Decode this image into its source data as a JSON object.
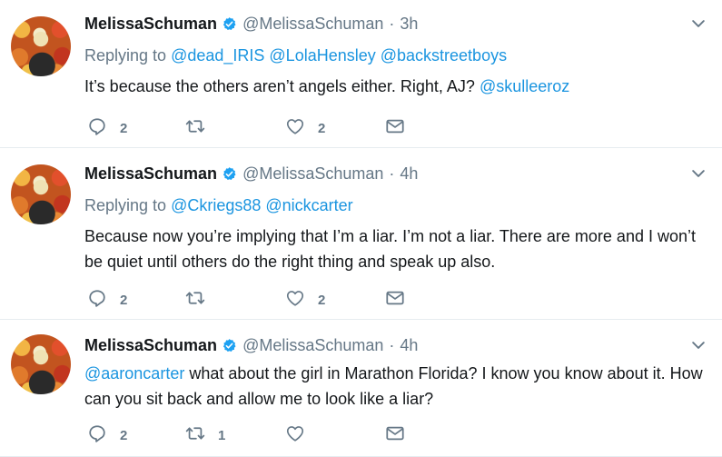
{
  "colors": {
    "link": "#1b95e0",
    "meta": "#657786",
    "text": "#14171a",
    "verified": "#1da1f2"
  },
  "tweets": [
    {
      "name": "MelissaSchuman",
      "handle": "@MelissaSchuman",
      "separator": "·",
      "time": "3h",
      "replying_prefix": "Replying to",
      "replying_to": [
        "@dead_IRIS",
        "@LolaHensley",
        "@backstreetboys"
      ],
      "text": "It’s because the others aren’t angels either. Right, AJ?",
      "text_mention_suffix": "@skulleeroz",
      "counts": {
        "replies": "2",
        "retweets": "",
        "likes": "2"
      }
    },
    {
      "name": "MelissaSchuman",
      "handle": "@MelissaSchuman",
      "separator": "·",
      "time": "4h",
      "replying_prefix": "Replying to",
      "replying_to": [
        "@Ckriegs88",
        "@nickcarter"
      ],
      "text": "Because now you’re implying that I’m a liar. I’m not a liar. There are more and I won’t be quiet until others do the right thing and speak up also.",
      "counts": {
        "replies": "2",
        "retweets": "",
        "likes": "2"
      }
    },
    {
      "name": "MelissaSchuman",
      "handle": "@MelissaSchuman",
      "separator": "·",
      "time": "4h",
      "text_mention_prefix": "@aaroncarter",
      "text": "what about the girl in Marathon Florida? I know you know about it. How can you sit back and allow me to look like a liar?",
      "counts": {
        "replies": "2",
        "retweets": "1",
        "likes": ""
      }
    }
  ],
  "icons": {
    "reply": "reply-icon",
    "retweet": "retweet-icon",
    "like": "heart-icon",
    "dm": "envelope-icon",
    "verified": "verified-badge-icon",
    "more": "chevron-down-icon"
  }
}
